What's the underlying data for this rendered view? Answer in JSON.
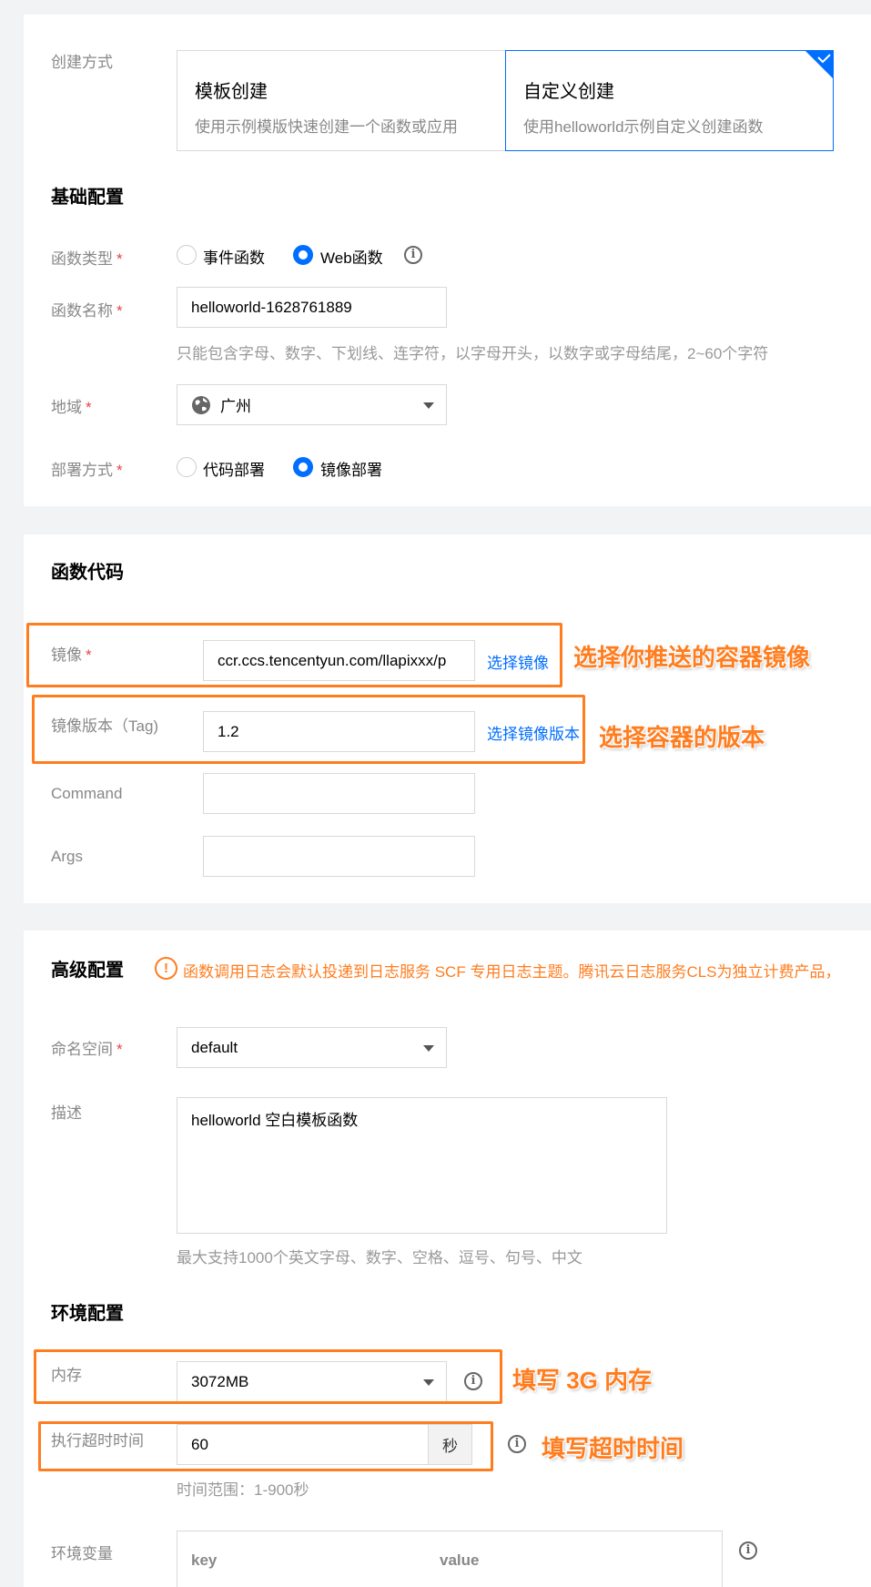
{
  "create_method": {
    "label": "创建方式",
    "options": [
      {
        "title": "模板创建",
        "desc": "使用示例模版快速创建一个函数或应用"
      },
      {
        "title": "自定义创建",
        "desc": "使用helloworld示例自定义创建函数"
      }
    ],
    "selected": "自定义创建"
  },
  "basic": {
    "title": "基础配置",
    "func_type": {
      "label": "函数类型",
      "options": [
        "事件函数",
        "Web函数"
      ],
      "selected": "Web函数"
    },
    "func_name": {
      "label": "函数名称",
      "value": "helloworld-1628761889",
      "hint": "只能包含字母、数字、下划线、连字符，以字母开头，以数字或字母结尾，2~60个字符"
    },
    "region": {
      "label": "地域",
      "value": "广州"
    },
    "deploy": {
      "label": "部署方式",
      "options": [
        "代码部署",
        "镜像部署"
      ],
      "selected": "镜像部署"
    }
  },
  "code": {
    "title": "函数代码",
    "image": {
      "label": "镜像",
      "value": "ccr.ccs.tencentyun.com/llapixxx/p",
      "link": "选择镜像"
    },
    "tag": {
      "label": "镜像版本（Tag)",
      "value": "1.2",
      "link": "选择镜像版本"
    },
    "command": {
      "label": "Command",
      "value": ""
    },
    "args": {
      "label": "Args",
      "value": ""
    }
  },
  "advanced": {
    "title": "高级配置",
    "notice": "函数调用日志会默认投递到日志服务 SCF 专用日志主题。腾讯云日志服务CLS为独立计费产品，",
    "namespace": {
      "label": "命名空间",
      "value": "default"
    },
    "description": {
      "label": "描述",
      "value": "helloworld 空白模板函数",
      "hint": "最大支持1000个英文字母、数字、空格、逗号、句号、中文"
    }
  },
  "env": {
    "title": "环境配置",
    "memory": {
      "label": "内存",
      "value": "3072MB"
    },
    "timeout": {
      "label": "执行超时时间",
      "value": "60",
      "unit": "秒",
      "hint": "时间范围：1-900秒"
    },
    "env_vars": {
      "label": "环境变量",
      "columns": [
        "key",
        "value"
      ]
    }
  },
  "annotations": {
    "image": "选择你推送的容器镜像",
    "tag": "选择容器的版本",
    "memory": "填写 3G 内存",
    "timeout": "填写超时时间"
  },
  "colors": {
    "accent": "#006eff",
    "annotation": "#ff7d1f",
    "required": "#e54545",
    "notice": "#ff7d1f"
  }
}
